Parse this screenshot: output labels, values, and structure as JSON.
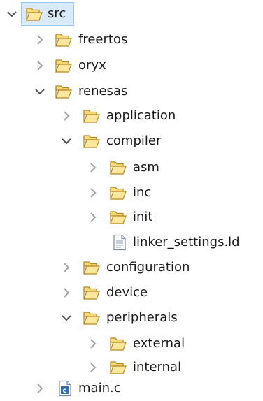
{
  "tree": {
    "items": [
      {
        "label": "src",
        "type": "folder",
        "expanded": true,
        "selected": true
      },
      {
        "label": "freertos",
        "type": "folder",
        "expanded": false
      },
      {
        "label": "oryx",
        "type": "folder",
        "expanded": false
      },
      {
        "label": "renesas",
        "type": "folder",
        "expanded": true
      },
      {
        "label": "application",
        "type": "folder",
        "expanded": false
      },
      {
        "label": "compiler",
        "type": "folder",
        "expanded": true
      },
      {
        "label": "asm",
        "type": "folder",
        "expanded": false
      },
      {
        "label": "inc",
        "type": "folder",
        "expanded": false
      },
      {
        "label": "init",
        "type": "folder",
        "expanded": false
      },
      {
        "label": "linker_settings.ld",
        "type": "text-file"
      },
      {
        "label": "configuration",
        "type": "folder",
        "expanded": false
      },
      {
        "label": "device",
        "type": "folder",
        "expanded": false
      },
      {
        "label": "peripherals",
        "type": "folder",
        "expanded": true
      },
      {
        "label": "external",
        "type": "folder",
        "expanded": false
      },
      {
        "label": "internal",
        "type": "folder",
        "expanded": false
      },
      {
        "label": "main.c",
        "type": "c-file",
        "expanded": false
      }
    ]
  },
  "colors": {
    "folder_fill": "#f7dc7a",
    "folder_stroke": "#b8861f",
    "selection": "#d9ebfb",
    "chevron_collapsed": "#a3a3a3",
    "chevron_expanded": "#505050",
    "c_badge": "#2d6fb5"
  }
}
